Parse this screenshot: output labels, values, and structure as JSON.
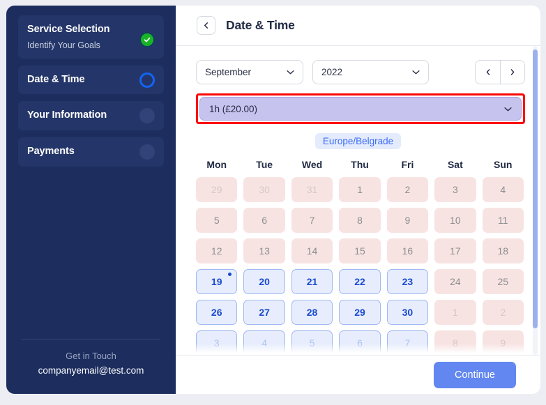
{
  "sidebar": {
    "steps": [
      {
        "title": "Service Selection",
        "subtitle": "Identify Your Goals",
        "state": "done"
      },
      {
        "title": "Date & Time",
        "subtitle": "",
        "state": "active"
      },
      {
        "title": "Your Information",
        "subtitle": "",
        "state": "idle"
      },
      {
        "title": "Payments",
        "subtitle": "",
        "state": "idle"
      }
    ],
    "footer": {
      "label": "Get in Touch",
      "email": "companyemail@test.com"
    }
  },
  "header": {
    "title": "Date & Time",
    "back_icon": "chevron-left-icon"
  },
  "controls": {
    "month": "September",
    "year": "2022",
    "prev_icon": "chevron-left-icon",
    "next_icon": "chevron-right-icon",
    "duration": "1h  (£20.00)",
    "timezone": "Europe/Belgrade"
  },
  "calendar": {
    "weekdays": [
      "Mon",
      "Tue",
      "Wed",
      "Thu",
      "Fri",
      "Sat",
      "Sun"
    ],
    "rows": [
      [
        {
          "label": "29",
          "state": "off",
          "muted": true
        },
        {
          "label": "30",
          "state": "off",
          "muted": true
        },
        {
          "label": "31",
          "state": "off",
          "muted": true
        },
        {
          "label": "1",
          "state": "off"
        },
        {
          "label": "2",
          "state": "off"
        },
        {
          "label": "3",
          "state": "off"
        },
        {
          "label": "4",
          "state": "off"
        }
      ],
      [
        {
          "label": "5",
          "state": "off"
        },
        {
          "label": "6",
          "state": "off"
        },
        {
          "label": "7",
          "state": "off"
        },
        {
          "label": "8",
          "state": "off"
        },
        {
          "label": "9",
          "state": "off"
        },
        {
          "label": "10",
          "state": "off"
        },
        {
          "label": "11",
          "state": "off"
        }
      ],
      [
        {
          "label": "12",
          "state": "off"
        },
        {
          "label": "13",
          "state": "off"
        },
        {
          "label": "14",
          "state": "off"
        },
        {
          "label": "15",
          "state": "off"
        },
        {
          "label": "16",
          "state": "off"
        },
        {
          "label": "17",
          "state": "off"
        },
        {
          "label": "18",
          "state": "off"
        }
      ],
      [
        {
          "label": "19",
          "state": "on",
          "today": true
        },
        {
          "label": "20",
          "state": "on"
        },
        {
          "label": "21",
          "state": "on"
        },
        {
          "label": "22",
          "state": "on"
        },
        {
          "label": "23",
          "state": "on"
        },
        {
          "label": "24",
          "state": "off"
        },
        {
          "label": "25",
          "state": "off"
        }
      ],
      [
        {
          "label": "26",
          "state": "on"
        },
        {
          "label": "27",
          "state": "on"
        },
        {
          "label": "28",
          "state": "on"
        },
        {
          "label": "29",
          "state": "on"
        },
        {
          "label": "30",
          "state": "on"
        },
        {
          "label": "1",
          "state": "off",
          "muted": true
        },
        {
          "label": "2",
          "state": "off",
          "muted": true
        }
      ],
      [
        {
          "label": "3",
          "state": "on",
          "next": true
        },
        {
          "label": "4",
          "state": "on",
          "next": true
        },
        {
          "label": "5",
          "state": "on",
          "next": true
        },
        {
          "label": "6",
          "state": "on",
          "next": true
        },
        {
          "label": "7",
          "state": "on",
          "next": true
        },
        {
          "label": "8",
          "state": "off",
          "muted": true
        },
        {
          "label": "9",
          "state": "off",
          "muted": true
        }
      ]
    ]
  },
  "footer": {
    "continue_label": "Continue"
  },
  "colors": {
    "sidebar_bg": "#1c2d5e",
    "step_bg": "#243669",
    "accent_blue": "#1463f3",
    "done_green": "#18b326",
    "available_text": "#1b49cf",
    "available_bg": "#e7edfd",
    "unavailable_bg": "#f7e4e2",
    "duration_bg": "#c7c3ef",
    "highlight_red": "#fb0707",
    "continue_bg": "#6287f0",
    "timezone_bg": "#e4ebfd",
    "timezone_text": "#3b6df5"
  }
}
